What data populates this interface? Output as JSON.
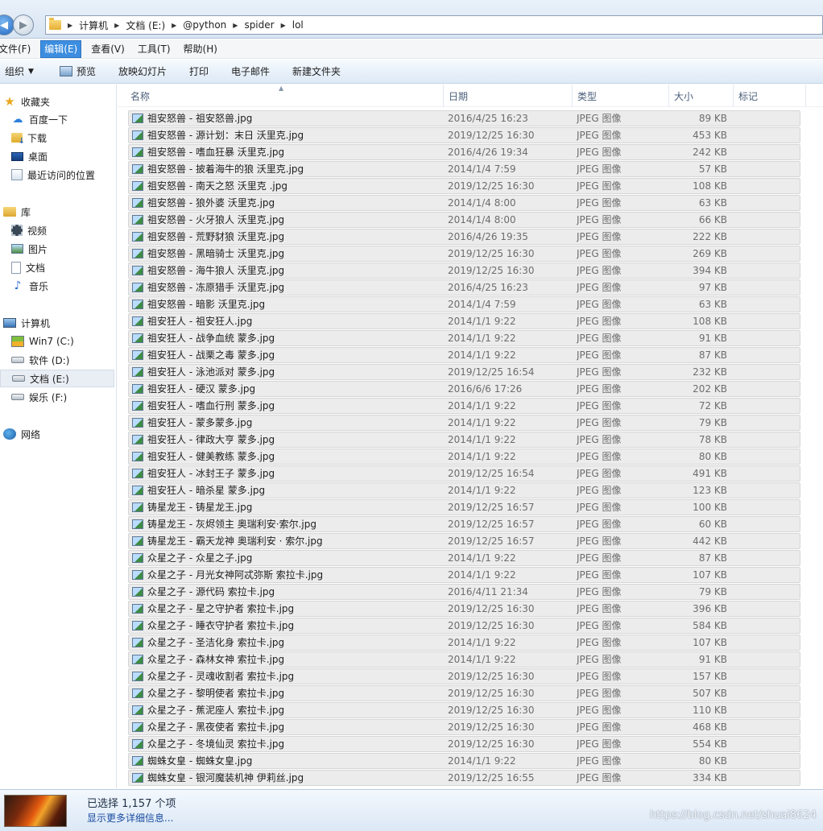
{
  "address": {
    "crumbs": [
      "计算机",
      "文档 (E:)",
      "@python",
      "spider",
      "lol"
    ]
  },
  "menu": {
    "items": [
      {
        "label": "文件(F)",
        "active": false
      },
      {
        "label": "编辑(E)",
        "active": true
      },
      {
        "label": "查看(V)",
        "active": false
      },
      {
        "label": "工具(T)",
        "active": false
      },
      {
        "label": "帮助(H)",
        "active": false
      }
    ]
  },
  "toolbar": {
    "organize": "组织",
    "preview": "预览",
    "slideshow": "放映幻灯片",
    "print": "打印",
    "email": "电子邮件",
    "new_folder": "新建文件夹"
  },
  "sidebar": {
    "items": [
      {
        "label": "收藏夹",
        "icon": "star-icon",
        "level": 0
      },
      {
        "label": "百度一下",
        "icon": "cloud-icon",
        "level": 1
      },
      {
        "label": "下载",
        "icon": "download-folder-icon",
        "level": 1
      },
      {
        "label": "桌面",
        "icon": "desktop-icon",
        "level": 1
      },
      {
        "label": "最近访问的位置",
        "icon": "recent-places-icon",
        "level": 1
      },
      {
        "label": "库",
        "icon": "library-icon",
        "level": 0
      },
      {
        "label": "视频",
        "icon": "video-icon",
        "level": 1
      },
      {
        "label": "图片",
        "icon": "picture-icon",
        "level": 1
      },
      {
        "label": "文档",
        "icon": "document-icon",
        "level": 1
      },
      {
        "label": "音乐",
        "icon": "music-icon",
        "level": 1
      },
      {
        "label": "计算机",
        "icon": "computer-icon",
        "level": 0
      },
      {
        "label": "Win7 (C:)",
        "icon": "system-drive-icon",
        "level": 1
      },
      {
        "label": "软件 (D:)",
        "icon": "drive-icon",
        "level": 1
      },
      {
        "label": "文档 (E:)",
        "icon": "drive-icon",
        "level": 1,
        "selected": true
      },
      {
        "label": "娱乐 (F:)",
        "icon": "drive-icon",
        "level": 1
      },
      {
        "label": "网络",
        "icon": "network-icon",
        "level": 0
      }
    ]
  },
  "columns": {
    "name": "名称",
    "date": "日期",
    "type": "类型",
    "size": "大小",
    "tags": "标记"
  },
  "files": [
    {
      "name": "祖安怒兽 - 祖安怒兽.jpg",
      "date": "2016/4/25 16:23",
      "type": "JPEG 图像",
      "size": "89 KB"
    },
    {
      "name": "祖安怒兽 - 源计划：末日 沃里克.jpg",
      "date": "2019/12/25 16:30",
      "type": "JPEG 图像",
      "size": "453 KB"
    },
    {
      "name": "祖安怒兽 - 嗜血狂暴 沃里克.jpg",
      "date": "2016/4/26 19:34",
      "type": "JPEG 图像",
      "size": "242 KB"
    },
    {
      "name": "祖安怒兽 - 披着海牛的狼 沃里克.jpg",
      "date": "2014/1/4 7:59",
      "type": "JPEG 图像",
      "size": "57 KB"
    },
    {
      "name": "祖安怒兽 - 南天之怒 沃里克 .jpg",
      "date": "2019/12/25 16:30",
      "type": "JPEG 图像",
      "size": "108 KB"
    },
    {
      "name": "祖安怒兽 - 狼外婆 沃里克.jpg",
      "date": "2014/1/4 8:00",
      "type": "JPEG 图像",
      "size": "63 KB"
    },
    {
      "name": "祖安怒兽 - 火牙狼人 沃里克.jpg",
      "date": "2014/1/4 8:00",
      "type": "JPEG 图像",
      "size": "66 KB"
    },
    {
      "name": "祖安怒兽 - 荒野豺狼 沃里克.jpg",
      "date": "2016/4/26 19:35",
      "type": "JPEG 图像",
      "size": "222 KB"
    },
    {
      "name": "祖安怒兽 - 黑暗骑士 沃里克.jpg",
      "date": "2019/12/25 16:30",
      "type": "JPEG 图像",
      "size": "269 KB"
    },
    {
      "name": "祖安怒兽 - 海牛狼人 沃里克.jpg",
      "date": "2019/12/25 16:30",
      "type": "JPEG 图像",
      "size": "394 KB"
    },
    {
      "name": "祖安怒兽 - 冻原猎手 沃里克.jpg",
      "date": "2016/4/25 16:23",
      "type": "JPEG 图像",
      "size": "97 KB"
    },
    {
      "name": "祖安怒兽 - 暗影 沃里克.jpg",
      "date": "2014/1/4 7:59",
      "type": "JPEG 图像",
      "size": "63 KB"
    },
    {
      "name": "祖安狂人 - 祖安狂人.jpg",
      "date": "2014/1/1 9:22",
      "type": "JPEG 图像",
      "size": "108 KB"
    },
    {
      "name": "祖安狂人 - 战争血统 蒙多.jpg",
      "date": "2014/1/1 9:22",
      "type": "JPEG 图像",
      "size": "91 KB"
    },
    {
      "name": "祖安狂人 - 战栗之毒 蒙多.jpg",
      "date": "2014/1/1 9:22",
      "type": "JPEG 图像",
      "size": "87 KB"
    },
    {
      "name": "祖安狂人 - 泳池派对 蒙多.jpg",
      "date": "2019/12/25 16:54",
      "type": "JPEG 图像",
      "size": "232 KB"
    },
    {
      "name": "祖安狂人 - 硬汉 蒙多.jpg",
      "date": "2016/6/6 17:26",
      "type": "JPEG 图像",
      "size": "202 KB"
    },
    {
      "name": "祖安狂人 - 嗜血行刑 蒙多.jpg",
      "date": "2014/1/1 9:22",
      "type": "JPEG 图像",
      "size": "72 KB"
    },
    {
      "name": "祖安狂人 - 蒙多蒙多.jpg",
      "date": "2014/1/1 9:22",
      "type": "JPEG 图像",
      "size": "79 KB"
    },
    {
      "name": "祖安狂人 - 律政大亨 蒙多.jpg",
      "date": "2014/1/1 9:22",
      "type": "JPEG 图像",
      "size": "78 KB"
    },
    {
      "name": "祖安狂人 - 健美教练 蒙多.jpg",
      "date": "2014/1/1 9:22",
      "type": "JPEG 图像",
      "size": "80 KB"
    },
    {
      "name": "祖安狂人 - 冰封王子 蒙多.jpg",
      "date": "2019/12/25 16:54",
      "type": "JPEG 图像",
      "size": "491 KB"
    },
    {
      "name": "祖安狂人 - 暗杀星 蒙多.jpg",
      "date": "2014/1/1 9:22",
      "type": "JPEG 图像",
      "size": "123 KB"
    },
    {
      "name": "铸星龙王 - 铸星龙王.jpg",
      "date": "2019/12/25 16:57",
      "type": "JPEG 图像",
      "size": "100 KB"
    },
    {
      "name": "铸星龙王 - 灰烬领主 奥瑞利安·索尔.jpg",
      "date": "2019/12/25 16:57",
      "type": "JPEG 图像",
      "size": "60 KB"
    },
    {
      "name": "铸星龙王 - 霸天龙神 奥瑞利安 · 索尔.jpg",
      "date": "2019/12/25 16:57",
      "type": "JPEG 图像",
      "size": "442 KB"
    },
    {
      "name": "众星之子 - 众星之子.jpg",
      "date": "2014/1/1 9:22",
      "type": "JPEG 图像",
      "size": "87 KB"
    },
    {
      "name": "众星之子 - 月光女神阿忒弥斯 索拉卡.jpg",
      "date": "2014/1/1 9:22",
      "type": "JPEG 图像",
      "size": "107 KB"
    },
    {
      "name": "众星之子 - 源代码 索拉卡.jpg",
      "date": "2016/4/11 21:34",
      "type": "JPEG 图像",
      "size": "79 KB"
    },
    {
      "name": "众星之子 - 星之守护者 索拉卡.jpg",
      "date": "2019/12/25 16:30",
      "type": "JPEG 图像",
      "size": "396 KB"
    },
    {
      "name": "众星之子 - 睡衣守护者 索拉卡.jpg",
      "date": "2019/12/25 16:30",
      "type": "JPEG 图像",
      "size": "584 KB"
    },
    {
      "name": "众星之子 - 圣洁化身 索拉卡.jpg",
      "date": "2014/1/1 9:22",
      "type": "JPEG 图像",
      "size": "107 KB"
    },
    {
      "name": "众星之子 - 森林女神 索拉卡.jpg",
      "date": "2014/1/1 9:22",
      "type": "JPEG 图像",
      "size": "91 KB"
    },
    {
      "name": "众星之子 - 灵魂收割者 索拉卡.jpg",
      "date": "2019/12/25 16:30",
      "type": "JPEG 图像",
      "size": "157 KB"
    },
    {
      "name": "众星之子 - 黎明使者 索拉卡.jpg",
      "date": "2019/12/25 16:30",
      "type": "JPEG 图像",
      "size": "507 KB"
    },
    {
      "name": "众星之子 - 蕉泥座人 索拉卡.jpg",
      "date": "2019/12/25 16:30",
      "type": "JPEG 图像",
      "size": "110 KB"
    },
    {
      "name": "众星之子 - 黑夜使者 索拉卡.jpg",
      "date": "2019/12/25 16:30",
      "type": "JPEG 图像",
      "size": "468 KB"
    },
    {
      "name": "众星之子 - 冬境仙灵 索拉卡.jpg",
      "date": "2019/12/25 16:30",
      "type": "JPEG 图像",
      "size": "554 KB"
    },
    {
      "name": "蜘蛛女皇 - 蜘蛛女皇.jpg",
      "date": "2014/1/1 9:22",
      "type": "JPEG 图像",
      "size": "80 KB"
    },
    {
      "name": "蜘蛛女皇 - 银河魔装机神 伊莉丝.jpg",
      "date": "2019/12/25 16:55",
      "type": "JPEG 图像",
      "size": "334 KB"
    }
  ],
  "status": {
    "selected": "已选择 1,157 个项",
    "details_link": "显示更多详细信息...",
    "watermark": "https://blog.csdn.net/shuai8624"
  }
}
